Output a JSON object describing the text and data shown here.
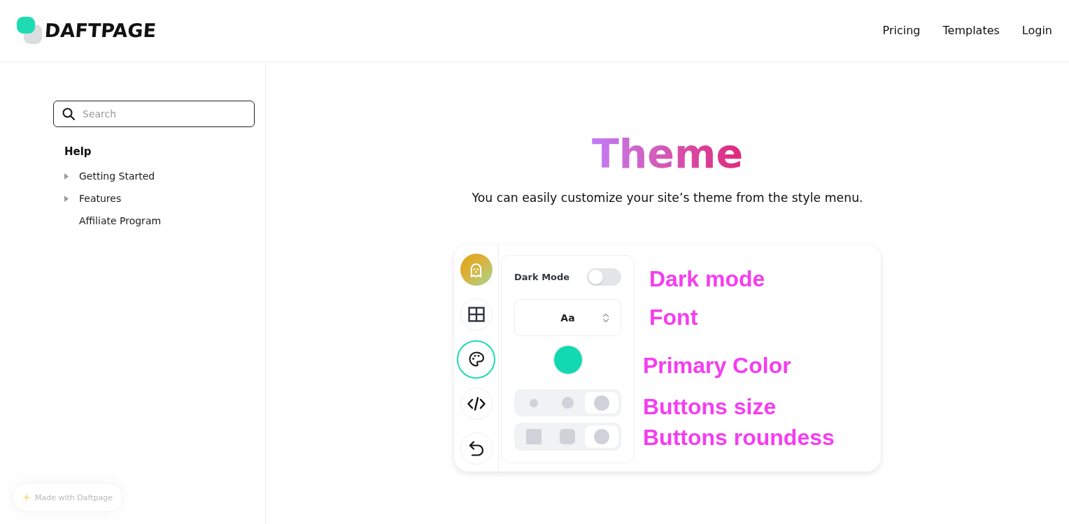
{
  "header": {
    "logo": "DAFTPAGE",
    "nav": [
      {
        "label": "Pricing"
      },
      {
        "label": "Templates"
      },
      {
        "label": "Login"
      }
    ]
  },
  "sidebar": {
    "search": {
      "placeholder": "Search"
    },
    "section": "Help",
    "items": [
      {
        "label": "Getting Started",
        "expandable": true,
        "expanded": false
      },
      {
        "label": "Features",
        "expandable": true,
        "expanded": false
      },
      {
        "label": "Affiliate Program",
        "expandable": false
      }
    ]
  },
  "article": {
    "title": "Theme",
    "intro": "You can easily customize your site’s theme from the style menu.",
    "screenshot": {
      "tools": [
        {
          "kind": "avatar",
          "selected": false
        },
        {
          "kind": "grid",
          "selected": false
        },
        {
          "kind": "palette",
          "selected": true
        },
        {
          "kind": "code",
          "selected": false
        },
        {
          "kind": "undo",
          "selected": false
        }
      ],
      "panel": {
        "dark_mode": {
          "label": "Dark Mode",
          "on": false
        },
        "font_select": {
          "value": "Aa"
        },
        "primary_color": {
          "color": "#12d9b0"
        },
        "button_sizes": [
          {
            "kind": "small",
            "selected": false
          },
          {
            "kind": "medium",
            "selected": false
          },
          {
            "kind": "large",
            "selected": true
          }
        ],
        "button_shapes": [
          {
            "kind": "square",
            "selected": false
          },
          {
            "kind": "rounded",
            "selected": false
          },
          {
            "kind": "round",
            "selected": true
          }
        ]
      },
      "annotations": [
        "Dark mode",
        "Font",
        "Primary Color",
        "Buttons size",
        "Buttons roundess"
      ]
    }
  },
  "badge": {
    "label": "Made with Daftpage"
  }
}
